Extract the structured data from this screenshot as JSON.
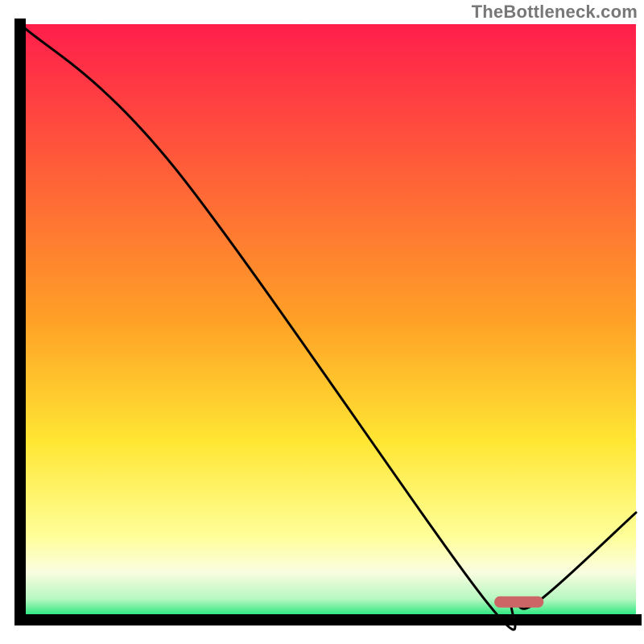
{
  "watermark": "TheBottleneck.com",
  "chart_data": {
    "type": "line",
    "title": "",
    "xlabel": "",
    "ylabel": "",
    "xlim": [
      0,
      100
    ],
    "ylim": [
      0,
      100
    ],
    "grid": false,
    "legend": false,
    "curve": [
      {
        "x": 0,
        "y": 100
      },
      {
        "x": 25,
        "y": 76
      },
      {
        "x": 75,
        "y": 4
      },
      {
        "x": 80,
        "y": 3
      },
      {
        "x": 84,
        "y": 3
      },
      {
        "x": 100,
        "y": 18
      }
    ],
    "marker": {
      "x_start": 77,
      "x_end": 85,
      "y": 3
    },
    "gradient_stops": [
      {
        "offset": 0,
        "color": "#ff1e4b"
      },
      {
        "offset": 0.5,
        "color": "#ffa126"
      },
      {
        "offset": 0.7,
        "color": "#ffe633"
      },
      {
        "offset": 0.86,
        "color": "#ffff99"
      },
      {
        "offset": 0.92,
        "color": "#fafde0"
      },
      {
        "offset": 0.965,
        "color": "#b7f7c1"
      },
      {
        "offset": 1.0,
        "color": "#00e36a"
      }
    ],
    "axis_color": "#000000",
    "curve_color": "#000000",
    "marker_color": "#cc6666"
  }
}
